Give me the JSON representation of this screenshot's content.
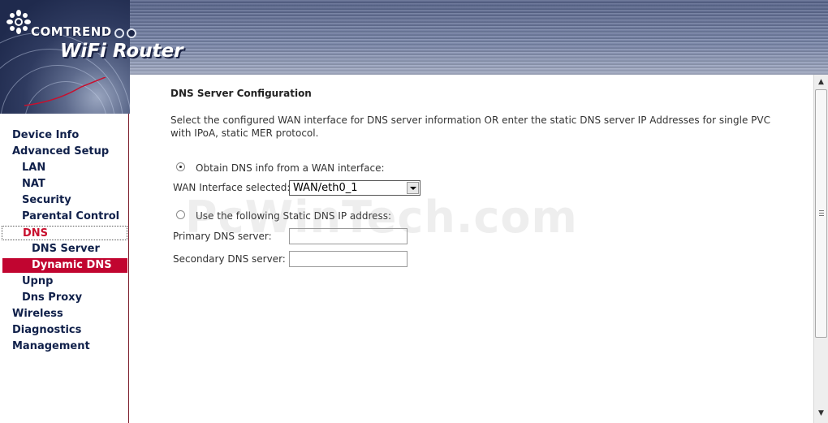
{
  "header": {
    "brand": "COMTREND",
    "product": "WiFi Router"
  },
  "sidebar": {
    "items": [
      {
        "label": "Device Info"
      },
      {
        "label": "Advanced Setup"
      },
      {
        "label": "LAN"
      },
      {
        "label": "NAT"
      },
      {
        "label": "Security"
      },
      {
        "label": "Parental Control"
      },
      {
        "label": "DNS"
      },
      {
        "label": "DNS Server"
      },
      {
        "label": "Dynamic DNS"
      },
      {
        "label": "Upnp"
      },
      {
        "label": "Dns Proxy"
      },
      {
        "label": "Wireless"
      },
      {
        "label": "Diagnostics"
      },
      {
        "label": "Management"
      }
    ]
  },
  "main": {
    "title": "DNS Server Configuration",
    "description": "Select the configured WAN interface for DNS server information OR enter the static DNS server IP Addresses for single PVC with IPoA, static MER protocol.",
    "option_wan_label": "Obtain DNS info from a WAN interface:",
    "wan_interface_label": "WAN Interface selected:",
    "wan_interface_value": "WAN/eth0_1",
    "option_static_label": "Use the following Static DNS IP address:",
    "primary_dns_label": "Primary DNS server:",
    "primary_dns_value": "",
    "secondary_dns_label": "Secondary DNS server:",
    "secondary_dns_value": ""
  },
  "watermark": "PcWinTech.com",
  "colors": {
    "selected_bg": "#c10530",
    "current_text": "#c8102e",
    "nav_text": "#10204a"
  }
}
